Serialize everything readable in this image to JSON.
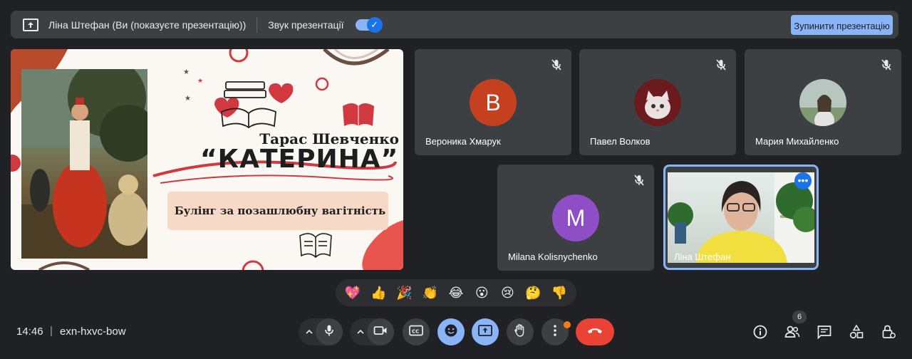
{
  "presenting_bar": {
    "label": "Ліна Штефан (Ви (показуєте презентацію))",
    "sound_label": "Звук презентації",
    "sound_enabled": true,
    "stop_button": "Зупинити презентацію"
  },
  "slide": {
    "author": "Тарас Шевченко",
    "title": "“КАТЕРИНА”",
    "subtitle": "Булінг за позашлюбну вагітність"
  },
  "participants": [
    {
      "name": "Вероника Хмарук",
      "initial": "В",
      "avatar_color": "#c5401f",
      "muted": true
    },
    {
      "name": "Павел Волков",
      "initial": "",
      "avatar_color": "#6b1a1e",
      "muted": true
    },
    {
      "name": "Мария Михайленко",
      "initial": "",
      "avatar_color": "#9aa6a0",
      "muted": true
    },
    {
      "name": "Milana Kolisnychenko",
      "initial": "M",
      "avatar_color": "#8e4ec6",
      "muted": true
    }
  ],
  "self_tile": {
    "name": "Ліна Штефан",
    "more_label": "•••"
  },
  "reactions": [
    "💖",
    "👍",
    "🎉",
    "👏",
    "😂",
    "😮",
    "😢",
    "🤔",
    "👎"
  ],
  "meeting": {
    "time": "14:46",
    "separator": "|",
    "code": "exn-hxvc-bow"
  },
  "controls": {
    "people_count": "6"
  },
  "colors": {
    "background": "#202124",
    "tile": "#3c4043",
    "accent": "#8ab4f8",
    "hangup": "#ea4335"
  }
}
